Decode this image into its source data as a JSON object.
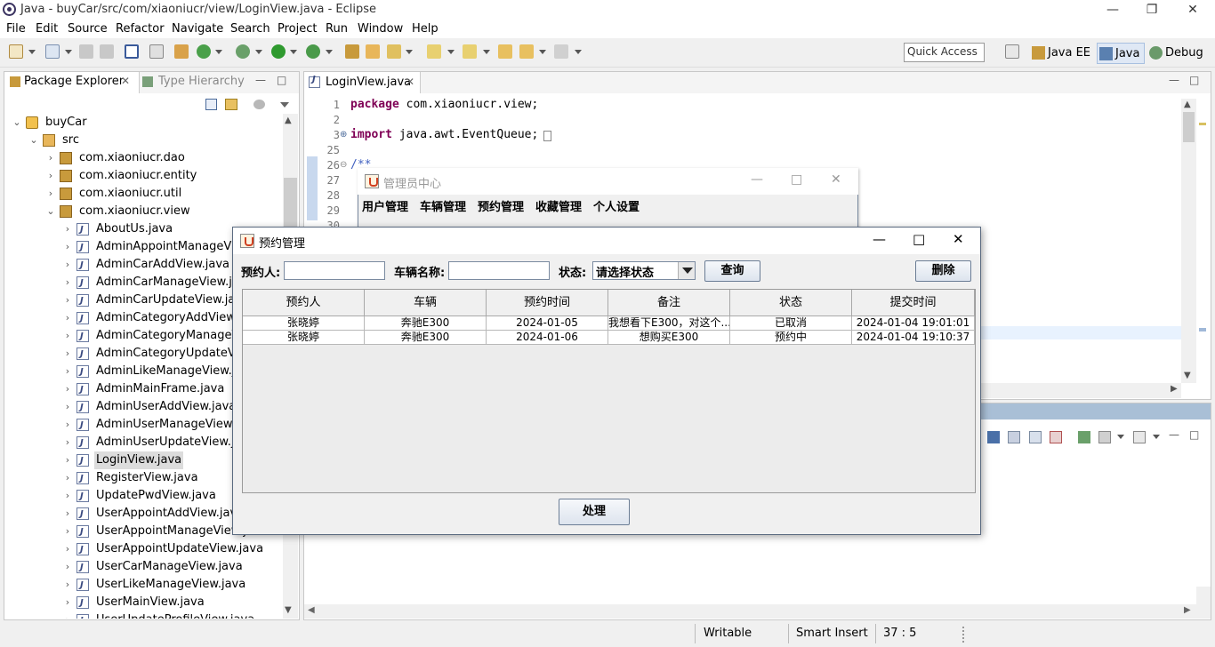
{
  "window": {
    "title": "Java - buyCar/src/com/xiaoniucr/view/LoginView.java - Eclipse",
    "minimize": "—",
    "restore": "❐",
    "close": "✕"
  },
  "menu": [
    "File",
    "Edit",
    "Source",
    "Refactor",
    "Navigate",
    "Search",
    "Project",
    "Run",
    "Window",
    "Help"
  ],
  "toolbar": {
    "quick_access_placeholder": "Quick Access",
    "perspectives": [
      "Java EE",
      "Java",
      "Debug"
    ]
  },
  "package_explorer": {
    "tabs": [
      "Package Explorer",
      "Type Hierarchy"
    ],
    "tree": [
      {
        "label": "buyCar",
        "level": 0,
        "icon": "project",
        "expanded": true
      },
      {
        "label": "src",
        "level": 1,
        "icon": "source-folder",
        "expanded": true
      },
      {
        "label": "com.xiaoniucr.dao",
        "level": 2,
        "icon": "package",
        "expanded": false
      },
      {
        "label": "com.xiaoniucr.entity",
        "level": 2,
        "icon": "package",
        "expanded": false
      },
      {
        "label": "com.xiaoniucr.util",
        "level": 2,
        "icon": "package",
        "expanded": false
      },
      {
        "label": "com.xiaoniucr.view",
        "level": 2,
        "icon": "package",
        "expanded": true
      },
      {
        "label": "AboutUs.java",
        "level": 3,
        "icon": "java-file"
      },
      {
        "label": "AdminAppointManageView.java",
        "level": 3,
        "icon": "java-file"
      },
      {
        "label": "AdminCarAddView.java",
        "level": 3,
        "icon": "java-file"
      },
      {
        "label": "AdminCarManageView.java",
        "level": 3,
        "icon": "java-file"
      },
      {
        "label": "AdminCarUpdateView.java",
        "level": 3,
        "icon": "java-file"
      },
      {
        "label": "AdminCategoryAddView.java",
        "level": 3,
        "icon": "java-file"
      },
      {
        "label": "AdminCategoryManageView.java",
        "level": 3,
        "icon": "java-file"
      },
      {
        "label": "AdminCategoryUpdateView.java",
        "level": 3,
        "icon": "java-file"
      },
      {
        "label": "AdminLikeManageView.java",
        "level": 3,
        "icon": "java-file"
      },
      {
        "label": "AdminMainFrame.java",
        "level": 3,
        "icon": "java-file"
      },
      {
        "label": "AdminUserAddView.java",
        "level": 3,
        "icon": "java-file"
      },
      {
        "label": "AdminUserManageView.java",
        "level": 3,
        "icon": "java-file"
      },
      {
        "label": "AdminUserUpdateView.java",
        "level": 3,
        "icon": "java-file"
      },
      {
        "label": "LoginView.java",
        "level": 3,
        "icon": "java-file",
        "selected": true
      },
      {
        "label": "RegisterView.java",
        "level": 3,
        "icon": "java-file"
      },
      {
        "label": "UpdatePwdView.java",
        "level": 3,
        "icon": "java-file"
      },
      {
        "label": "UserAppointAddView.java",
        "level": 3,
        "icon": "java-file"
      },
      {
        "label": "UserAppointManageView.java",
        "level": 3,
        "icon": "java-file"
      },
      {
        "label": "UserAppointUpdateView.java",
        "level": 3,
        "icon": "java-file"
      },
      {
        "label": "UserCarManageView.java",
        "level": 3,
        "icon": "java-file"
      },
      {
        "label": "UserLikeManageView.java",
        "level": 3,
        "icon": "java-file"
      },
      {
        "label": "UserMainView.java",
        "level": 3,
        "icon": "java-file"
      },
      {
        "label": "UserUpdateProfileView.java",
        "level": 3,
        "icon": "java-file"
      }
    ]
  },
  "editor": {
    "tab": "LoginView.java",
    "lines": [
      {
        "num": "1",
        "kw": "package",
        "rest": " com.xiaoniucr.view;"
      },
      {
        "num": "2",
        "kw": "",
        "rest": ""
      },
      {
        "num": "3",
        "kw": "import",
        "rest": " java.awt.EventQueue;"
      },
      {
        "num": "25",
        "kw": "",
        "rest": ""
      },
      {
        "num": "26",
        "kw": "",
        "rest": "/**"
      },
      {
        "num": "27",
        "kw": "",
        "rest": ""
      },
      {
        "num": "28",
        "kw": "",
        "rest": ""
      },
      {
        "num": "29",
        "kw": "",
        "rest": ""
      },
      {
        "num": "30",
        "kw": "",
        "rest": ""
      }
    ]
  },
  "status": {
    "writable": "Writable",
    "insert_mode": "Smart Insert",
    "position": "37 : 5"
  },
  "admin_window": {
    "title": "管理员中心",
    "menu": [
      "用户管理",
      "车辆管理",
      "预约管理",
      "收藏管理",
      "个人设置"
    ]
  },
  "appoint_dialog": {
    "title": "预约管理",
    "filters": {
      "person_label": "预约人:",
      "person_value": "",
      "car_label": "车辆名称:",
      "car_value": "",
      "status_label": "状态:",
      "status_selected": "请选择状态"
    },
    "query_button": "查询",
    "delete_button": "删除",
    "process_button": "处理",
    "table": {
      "columns": [
        "预约人",
        "车辆",
        "预约时间",
        "备注",
        "状态",
        "提交时间"
      ],
      "rows": [
        [
          "张晓婷",
          "奔驰E300",
          "2024-01-05",
          "我想看下E300，对这个...",
          "已取消",
          "2024-01-04 19:01:01"
        ],
        [
          "张晓婷",
          "奔驰E300",
          "2024-01-06",
          "想购买E300",
          "预约中",
          "2024-01-04 19:10:37"
        ]
      ]
    }
  }
}
